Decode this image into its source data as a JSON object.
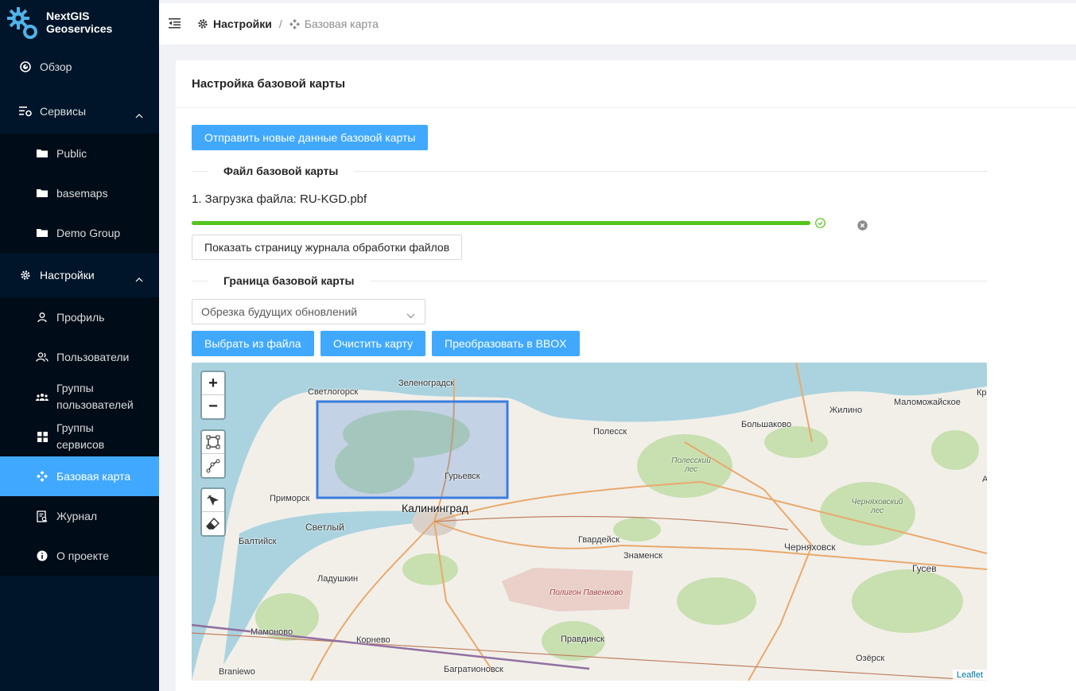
{
  "app": {
    "name_line1": "NextGIS",
    "name_line2": "Geoservices"
  },
  "sidebar": {
    "overview": "Обзор",
    "services": "Сервисы",
    "services_items": [
      "Public",
      "basemaps",
      "Demo Group"
    ],
    "settings": "Настройки",
    "settings_items": {
      "profile": "Профиль",
      "users": "Пользователи",
      "user_groups_l1": "Группы",
      "user_groups_l2": "пользователей",
      "service_groups_l1": "Группы",
      "service_groups_l2": "сервисов",
      "basemap": "Базовая карта",
      "journal": "Журнал"
    },
    "about": "О проекте"
  },
  "breadcrumb": {
    "home": "Настройки",
    "separator": "/",
    "current": "Базовая карта"
  },
  "card": {
    "title": "Настройка базовой карты",
    "send_button": "Отправить новые данные базовой карты",
    "file_section": "Файл базовой карты",
    "upload_label": "1. Загрузка файла: RU-KGD.pbf",
    "progress_percent": 100,
    "log_button": "Показать страницу журнала обработки файлов",
    "border_section": "Граница базовой карты",
    "select_value": "Обрезка будущих обновлений",
    "choose_file_button": "Выбрать из файла",
    "clear_map_button": "Очистить карту",
    "bbox_button": "Преобразовать в BBOX"
  },
  "map": {
    "zoom_in": "+",
    "zoom_out": "−",
    "attribution": "Leaflet",
    "labels": {
      "svetlogorsk": "Светлогорск",
      "zelenogradsk": "Зеленоградск",
      "polessk": "Полесск",
      "bolshakovo": "Большаково",
      "zhilino": "Жилино",
      "malomozhayskoe": "Маломожайское",
      "kr": "Кр",
      "polessky_les": "Полесский лес",
      "guryevsk": "Гурьевск",
      "primorsk": "Приморск",
      "kaliningrad": "Калининград",
      "svetly": "Светлый",
      "baltiysk": "Балтийск",
      "gvardeysk": "Гвардейск",
      "znamensk": "Знаменск",
      "chernyakhovsk": "Черняховск",
      "chernyakhovsky_les": "Черняховский лес",
      "gusev": "Гусев",
      "ladushkin": "Ладушкин",
      "poligon": "Полигон Павенково",
      "mamonovo": "Мамоново",
      "kornevo": "Корнево",
      "pravdinsk": "Правдинск",
      "ozyorsk": "Озёрск",
      "braniewo": "Braniewo",
      "bagrationovsk": "Багратионовск",
      "a_edge": "А"
    }
  },
  "colors": {
    "primary": "#40a9ff",
    "sidebar": "#001529",
    "success": "#52c41a",
    "bbox": "#3a7de0"
  }
}
